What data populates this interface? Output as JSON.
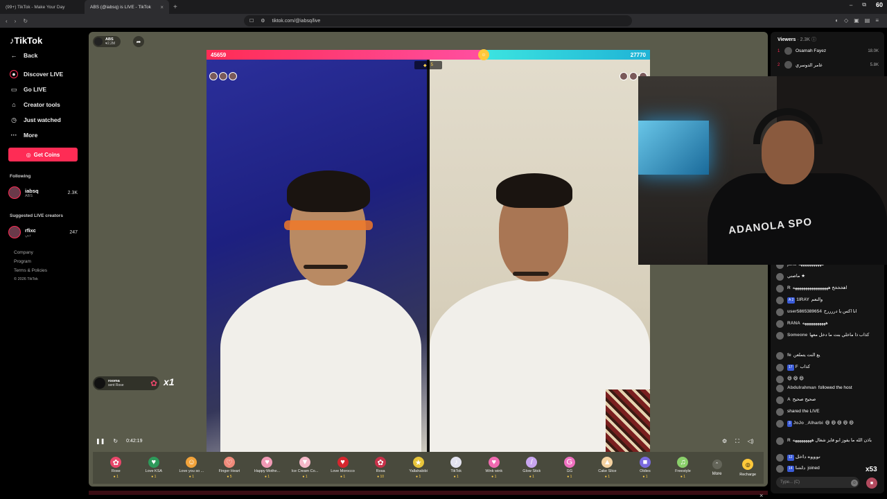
{
  "browser": {
    "tabs": [
      {
        "label": "(99+) TikTok - Make Your Day"
      },
      {
        "label": "ABS (@iabsq) is LIVE - TikTok"
      }
    ],
    "url": "tiktok.com/@iabsq/live",
    "window_badge": "60"
  },
  "nav": {
    "logo": "TikTok",
    "back": "Back",
    "items": [
      "Discover LIVE",
      "Go LIVE",
      "Creator tools",
      "Just watched",
      "More"
    ],
    "get_coins": "Get Coins",
    "following_title": "Following",
    "following": {
      "name": "iabsq",
      "sub": "ABS",
      "count": "2.3K"
    },
    "suggested_title": "Suggested LIVE creators",
    "suggested": {
      "name": "rfixc",
      "sub": "دبي",
      "count": "247"
    },
    "footer": [
      "Company",
      "Program",
      "Terms & Policies",
      "© 2026 TikTok"
    ]
  },
  "stage": {
    "host_name": "ABS",
    "host_likes": "2.2M",
    "score_left": "45659",
    "score_right": "27770",
    "mid_count": "5",
    "gift_pop": {
      "user": "rooma",
      "action": "sent Rose",
      "multiplier": "x1"
    },
    "timer": "0:42:19",
    "gifts": [
      {
        "name": "Rose",
        "price": "1",
        "color": "#e8476a",
        "glyph": "✿"
      },
      {
        "name": "Love KSA",
        "price": "1",
        "color": "#2d9a5a",
        "glyph": "♥"
      },
      {
        "name": "Love you so ...",
        "price": "1",
        "color": "#f2a33a",
        "glyph": "☺"
      },
      {
        "name": "Finger Heart",
        "price": "5",
        "color": "#f08a7a",
        "glyph": "♡"
      },
      {
        "name": "Happy Mothe...",
        "price": "1",
        "color": "#f19ab5",
        "glyph": "♥"
      },
      {
        "name": "Ice Cream Co...",
        "price": "1",
        "color": "#f5b8c8",
        "glyph": "▼"
      },
      {
        "name": "Love Morocco",
        "price": "1",
        "color": "#d6262e",
        "glyph": "♥"
      },
      {
        "name": "Rosa",
        "price": "10",
        "color": "#c8324a",
        "glyph": "✿"
      },
      {
        "name": "Yallahabibi",
        "price": "1",
        "color": "#e8c53a",
        "glyph": "★"
      },
      {
        "name": "TikTok",
        "price": "1",
        "color": "#e3e3f0",
        "glyph": "♪"
      },
      {
        "name": "Wink wink",
        "price": "1",
        "color": "#f06ab0",
        "glyph": "♥"
      },
      {
        "name": "Glow Stick",
        "price": "1",
        "color": "#c9a6f0",
        "glyph": "/"
      },
      {
        "name": "GG",
        "price": "1",
        "color": "#f070c0",
        "glyph": "G"
      },
      {
        "name": "Cake Slice",
        "price": "1",
        "color": "#f5d2a0",
        "glyph": "▲"
      },
      {
        "name": "Oldies",
        "price": "1",
        "color": "#7a6ae0",
        "glyph": "■"
      },
      {
        "name": "Freestyle",
        "price": "1",
        "color": "#8ad06a",
        "glyph": "♫"
      }
    ],
    "more": "More",
    "recharge": "Recharge"
  },
  "chat": {
    "viewers_label": "Viewers",
    "viewers_count": "· 2.3K",
    "top_viewers": [
      {
        "rank": "1",
        "name": "Osamah Fayez",
        "score": "18.0K"
      },
      {
        "rank": "2",
        "name": "عامر الدوسري",
        "score": "5.8K"
      }
    ],
    "messages": [
      {
        "user": "jana",
        "text": "هههههههههههه"
      },
      {
        "user": "",
        "text": "ماصني ★"
      },
      {
        "user": "R",
        "text": "اهخخخخ هههههههههههههههههه"
      },
      {
        "user": "1IRAY",
        "text": "والنعم",
        "badge": "A 2"
      },
      {
        "user": "user5865389654",
        "text": "انا اكس يا دررررخ"
      },
      {
        "user": "RANA",
        "text": "هههههههههههه"
      },
      {
        "user": "Someone",
        "text": "كذاب ذا ماخلي بنت ما دخل معها"
      },
      {
        "user": "fe",
        "text": "يع النت يتملعن"
      },
      {
        "user": "F",
        "text": "كذاب",
        "badge": "17"
      },
      {
        "user": "",
        "text": "😆 😆 😆"
      },
      {
        "user": "Abdulrahman",
        "text": "followed the host"
      },
      {
        "user": "A",
        "text": "صحيح صحيح"
      },
      {
        "user": "",
        "text": "shared the LIVE"
      },
      {
        "user": "JoJo _Alharbi",
        "text": "😆 😆 😆 😆 😆",
        "badge": "3"
      },
      {
        "user": "R",
        "text": "باذن الله ما يفوز ابو فايز شغال هههههههههه"
      },
      {
        "user": "توووه داخل",
        "text": "",
        "badge": "12"
      },
      {
        "user": "دلشا",
        "text": "joined",
        "badge": "14"
      }
    ],
    "x_count": "x53",
    "input_placeholder": "Type... (C)"
  },
  "cam_shirt_text": "ADANOLA SPO"
}
